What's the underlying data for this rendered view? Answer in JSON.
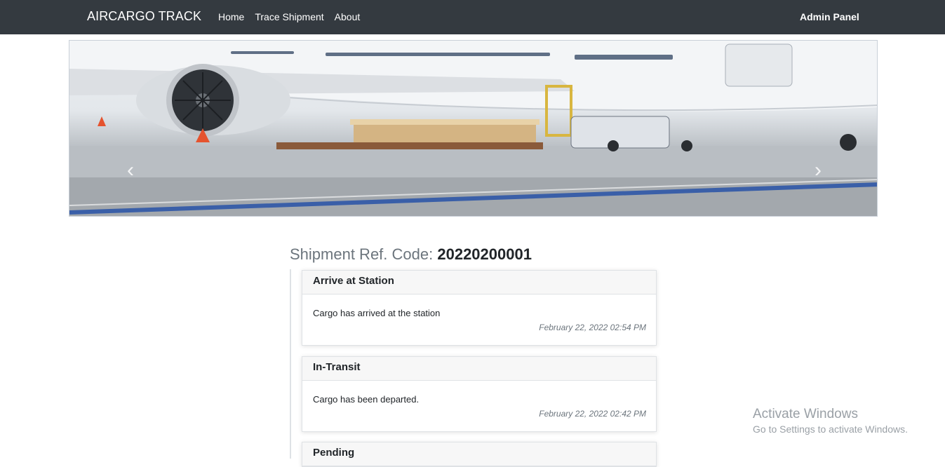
{
  "navbar": {
    "brand": "AIRCARGO TRACK",
    "links": [
      "Home",
      "Trace Shipment",
      "About"
    ],
    "admin": "Admin Panel",
    "bg_color": "#343a40"
  },
  "carousel": {
    "prev_icon": "chevron-left-icon",
    "next_icon": "chevron-right-icon",
    "prev_glyph": "‹",
    "next_glyph": "›"
  },
  "shipment": {
    "label": "Shipment Ref. Code:",
    "code": "20220200001"
  },
  "timeline": [
    {
      "status": "Arrive at Station",
      "description": "Cargo has arrived at the station",
      "date": "February 22, 2022 02:54 PM"
    },
    {
      "status": "In-Transit",
      "description": "Cargo has been departed.",
      "date": "February 22, 2022 02:42 PM"
    },
    {
      "status": "Pending",
      "description": "",
      "date": ""
    }
  ],
  "watermark": {
    "title": "Activate Windows",
    "subtitle": "Go to Settings to activate Windows."
  }
}
